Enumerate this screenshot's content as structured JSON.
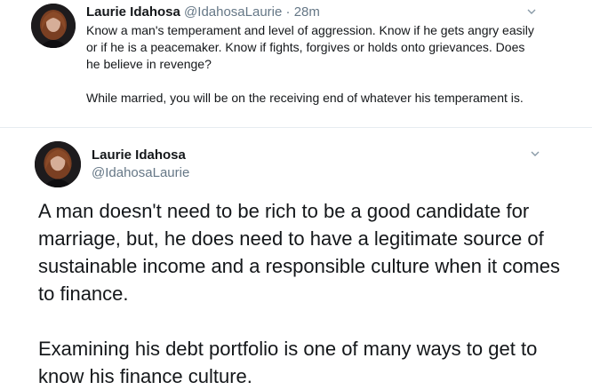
{
  "tweet_reply": {
    "author_name": "Laurie Idahosa",
    "author_handle": "@IdahosaLaurie",
    "separator": "·",
    "time": "28m",
    "paragraphs": [
      "Know a man's temperament and level of aggression. Know if he gets angry easily or if he is a peacemaker.  Know if fights, forgives or holds onto grievances. Does he believe in revenge?",
      "While married, you will be on the receiving end of whatever his temperament is."
    ],
    "menu_icon": "chevron-down-icon"
  },
  "tweet_main": {
    "author_name": "Laurie Idahosa",
    "author_handle": "@IdahosaLaurie",
    "paragraphs": [
      "A man doesn't need to be rich to be a good candidate for marriage, but, he does need to have a legitimate source of sustainable income and a responsible culture when it comes to finance.",
      "Examining his debt portfolio is one of many ways to get to know his finance culture."
    ],
    "menu_icon": "chevron-down-icon"
  },
  "colors": {
    "text_primary": "#14171a",
    "text_secondary": "#657786",
    "divider": "#e6ecf0"
  }
}
